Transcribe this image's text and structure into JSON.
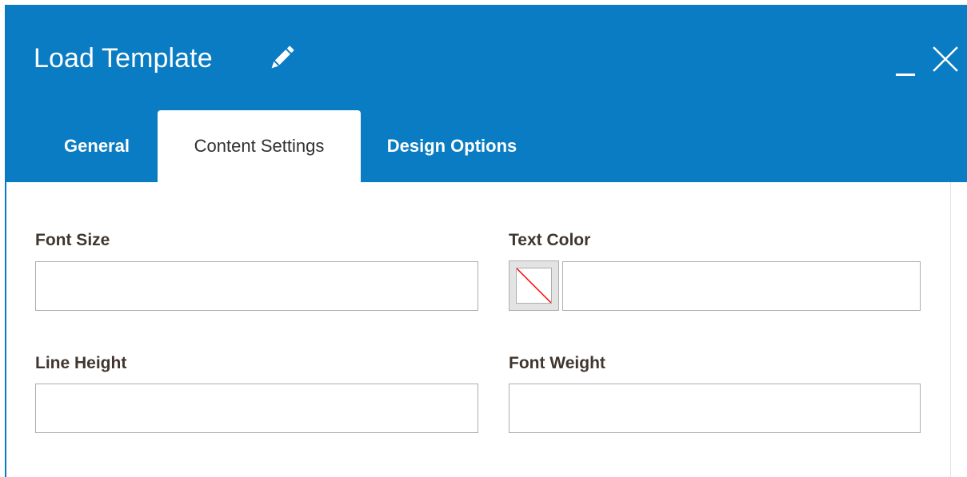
{
  "dialog": {
    "title": "Load Template",
    "title_icon": "pencil-icon",
    "minimize_icon": "minimize-icon",
    "close_icon": "close-icon"
  },
  "tabs": [
    {
      "label": "General",
      "active": false
    },
    {
      "label": "Content Settings",
      "active": true
    },
    {
      "label": "Design Options",
      "active": false
    }
  ],
  "form": {
    "font_size": {
      "label": "Font Size",
      "value": ""
    },
    "text_color": {
      "label": "Text Color",
      "value": "",
      "swatch_icon": "no-color-icon"
    },
    "line_height": {
      "label": "Line Height",
      "value": ""
    },
    "font_weight": {
      "label": "Font Weight",
      "value": ""
    }
  },
  "colors": {
    "header": "#0a7cc3",
    "label": "#41362f",
    "swatch_slash": "#ff0000"
  }
}
